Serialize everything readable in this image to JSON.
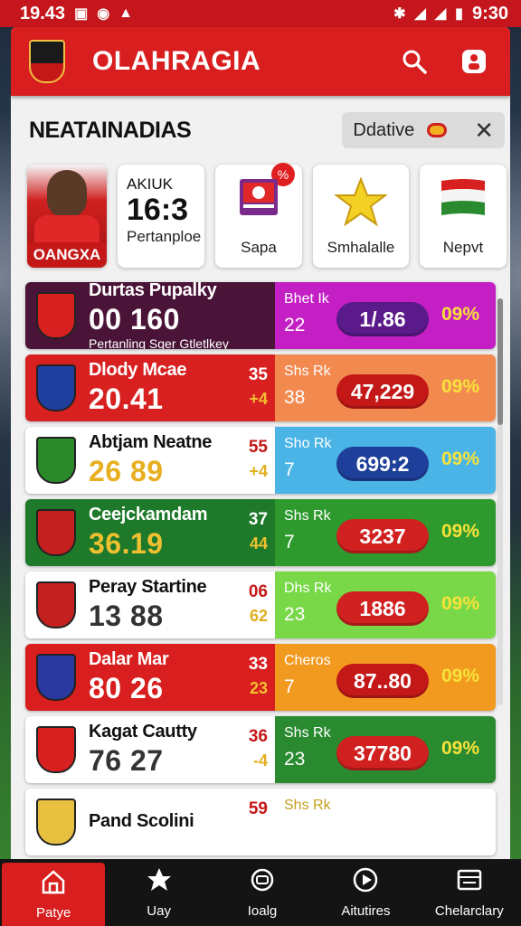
{
  "status_bar": {
    "time": "19.43",
    "right_time": "9:30"
  },
  "header": {
    "title": "OLAHRAGIA"
  },
  "section": {
    "title": "NEATAINADIAS",
    "filter_label": "Ddative"
  },
  "cards": {
    "player_name": "OANGXA",
    "score_top": "AKIUK",
    "score_big": "16:3",
    "score_label": "Pertanploe",
    "card3_label": "Sapa",
    "card4_label": "Smhalalle",
    "card5_label": "Nepvt",
    "notif": "%"
  },
  "rows": [
    {
      "name": "Durtas Pupalky",
      "score": "160",
      "prefix": "00",
      "sub": "Pertanling Sger Gtletlkey",
      "rank": "",
      "rank2": "",
      "tag": "Bhet Ik",
      "num": "22",
      "pill": "1/.86",
      "pct": "09%",
      "left_bg": "#4a1438",
      "right_bg": "#c41fc4",
      "pill_bg": "#5a1a8a",
      "name_color": "#ffffff",
      "score_color": "#ffffff",
      "tag_color": "#ffffff",
      "crest_bg": "#d82020"
    },
    {
      "name": "Dlody Mcae",
      "score": "20.41",
      "prefix": "",
      "sub": "",
      "rank": "35",
      "rank2": "+4",
      "tag": "Shs Rk",
      "num": "38",
      "pill": "47,229",
      "pct": "09%",
      "left_bg": "#d82020",
      "right_bg": "#f28a50",
      "pill_bg": "#c41818",
      "name_color": "#ffffff",
      "score_color": "#ffffff",
      "tag_color": "#ffffff",
      "crest_bg": "#2040a0"
    },
    {
      "name": "Abtjam Neatne",
      "score": "26 89",
      "prefix": "",
      "sub": "",
      "rank": "55",
      "rank2": "+4",
      "tag": "Sho Rk",
      "num": "7",
      "pill": "699:2",
      "pct": "09%",
      "left_bg": "#ffffff",
      "right_bg": "#4ab4e6",
      "pill_bg": "#1e3f9a",
      "name_color": "#111111",
      "score_color": "#e8b020",
      "tag_color": "#ffffff",
      "crest_bg": "#2a8a2a"
    },
    {
      "name": "Ceejckamdam",
      "score": "36.19",
      "prefix": "",
      "sub": "",
      "rank": "37",
      "rank2": "44",
      "tag": "Shs Rk",
      "num": "7",
      "pill": "3237",
      "pct": "09%",
      "left_bg": "#1e7a2a",
      "right_bg": "#2e9a2e",
      "pill_bg": "#d02020",
      "name_color": "#ffffff",
      "score_color": "#f0c030",
      "tag_color": "#ffffff",
      "crest_bg": "#c42020"
    },
    {
      "name": "Peray Startine",
      "score": "13 88",
      "prefix": "",
      "sub": "",
      "rank": "06",
      "rank2": "62",
      "tag": "Dhs Rk",
      "num": "23",
      "pill": "1886",
      "pct": "09%",
      "left_bg": "#ffffff",
      "right_bg": "#78d848",
      "pill_bg": "#d02020",
      "name_color": "#111111",
      "score_color": "#333333",
      "tag_color": "#ffffff",
      "crest_bg": "#c42020"
    },
    {
      "name": "Dalar Mar",
      "score": "80 26",
      "prefix": "",
      "sub": "",
      "rank": "33",
      "rank2": "23",
      "tag": "Cheros",
      "num": "7",
      "pill": "87..80",
      "pct": "09%",
      "left_bg": "#d81e1e",
      "right_bg": "#f29a20",
      "pill_bg": "#c41818",
      "name_color": "#ffffff",
      "score_color": "#ffffff",
      "tag_color": "#ffffff",
      "crest_bg": "#2a3aa0"
    },
    {
      "name": "Kagat Cautty",
      "score": "76 27",
      "prefix": "",
      "sub": "",
      "rank": "36",
      "rank2": "-4",
      "tag": "Shs Rk",
      "num": "23",
      "pill": "37780",
      "pct": "09%",
      "left_bg": "#ffffff",
      "right_bg": "#2a8a30",
      "pill_bg": "#d02020",
      "name_color": "#111111",
      "score_color": "#333333",
      "tag_color": "#ffffff",
      "crest_bg": "#d82020"
    },
    {
      "name": "Pand Scolini",
      "score": "",
      "prefix": "",
      "sub": "",
      "rank": "59",
      "rank2": "",
      "tag": "Shs Rk",
      "num": "",
      "pill": "",
      "pct": "",
      "left_bg": "#ffffff",
      "right_bg": "#ffffff",
      "pill_bg": "#ffffff",
      "name_color": "#111111",
      "score_color": "#333333",
      "tag_color": "#c4a020",
      "crest_bg": "#e8c040"
    }
  ],
  "nav": [
    {
      "label": "Patye",
      "icon": "home-icon"
    },
    {
      "label": "Uay",
      "icon": "star-burst-icon"
    },
    {
      "label": "Ioalg",
      "icon": "refresh-icon"
    },
    {
      "label": "Aitutires",
      "icon": "play-icon"
    },
    {
      "label": "Chelarclary",
      "icon": "calendar-icon"
    }
  ]
}
